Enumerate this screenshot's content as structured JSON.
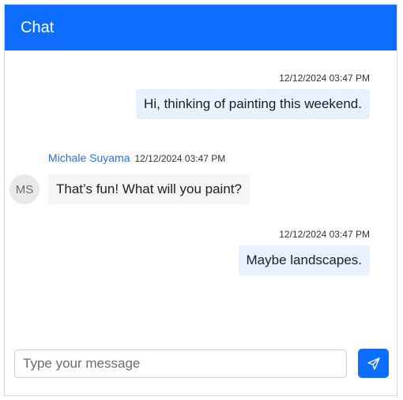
{
  "header": {
    "title": "Chat"
  },
  "messages": [
    {
      "direction": "outgoing",
      "timestamp": "12/12/2024 03:47 PM",
      "text": "Hi, thinking of painting this weekend."
    },
    {
      "direction": "incoming",
      "sender": "Michale Suyama",
      "avatar_initials": "MS",
      "timestamp": "12/12/2024 03:47 PM",
      "text": "That’s fun! What will you paint?"
    },
    {
      "direction": "outgoing",
      "timestamp": "12/12/2024 03:47 PM",
      "text": "Maybe landscapes."
    }
  ],
  "composer": {
    "placeholder": "Type your message",
    "value": "",
    "send_icon": "send-icon"
  },
  "colors": {
    "accent": "#0d6efd",
    "outgoing_bubble": "#e7f1ff",
    "incoming_bubble": "#f5f5f5",
    "sender_name": "#2f6fce"
  }
}
